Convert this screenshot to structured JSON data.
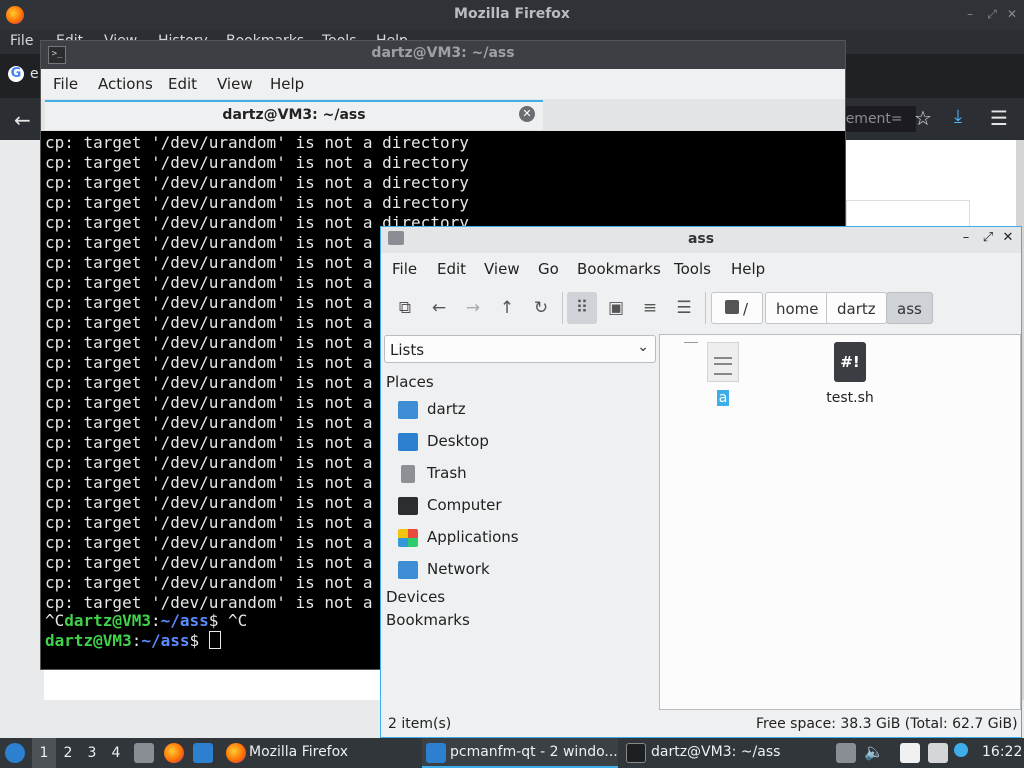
{
  "firefox": {
    "title": "Mozilla Firefox",
    "menu": [
      "File",
      "Edit",
      "View",
      "History",
      "Bookmarks",
      "Tools",
      "Help"
    ],
    "tab_favicon": "G",
    "tab_title": "e",
    "url_fragment": "cement=",
    "icons": {
      "back": "←",
      "star": "☆",
      "download": "⤓",
      "menu": "☰",
      "min": "–",
      "max": "⤢",
      "close": "✕"
    }
  },
  "terminal": {
    "title": "dartz@VM3: ~/ass",
    "menu": [
      "File",
      "Actions",
      "Edit",
      "View",
      "Help"
    ],
    "tab_title": "dartz@VM3: ~/ass",
    "tab_close": "✕",
    "line_text": "cp: target '/dev/urandom' is not a directory",
    "lines": [
      "cp: target '/dev/urandom' is not a directory",
      "cp: target '/dev/urandom' is not a directory",
      "cp: target '/dev/urandom' is not a directory",
      "cp: target '/dev/urandom' is not a directory",
      "cp: target '/dev/urandom' is not a directory",
      "cp: target '/dev/urandom' is not a directory",
      "cp: target '/dev/urandom' is not a directory",
      "cp: target '/dev/urandom' is not a directory",
      "cp: target '/dev/urandom' is not a directory",
      "cp: target '/dev/urandom' is not a directory",
      "cp: target '/dev/urandom' is not a directory",
      "cp: target '/dev/urandom' is not a directory",
      "cp: target '/dev/urandom' is not a directory",
      "cp: target '/dev/urandom' is not a directory",
      "cp: target '/dev/urandom' is not a directory",
      "cp: target '/dev/urandom' is not a directory",
      "cp: target '/dev/urandom' is not a directory",
      "cp: target '/dev/urandom' is not a directory",
      "cp: target '/dev/urandom' is not a directory",
      "cp: target '/dev/urandom' is not a directory",
      "cp: target '/dev/urandom' is not a directory",
      "cp: target '/dev/urandom' is not a directory",
      "cp: target '/dev/urandom' is not a directory",
      "cp: target '/dev/urandom' is not a directory"
    ],
    "prompt1": {
      "prefix": "^C",
      "user": "dartz@VM3",
      "sep": ":",
      "path": "~/ass",
      "suffix": "$ ^C"
    },
    "prompt2": {
      "user": "dartz@VM3",
      "sep": ":",
      "path": "~/ass",
      "suffix": "$ "
    }
  },
  "filemanager": {
    "title": "ass",
    "menu": [
      "File",
      "Edit",
      "View",
      "Go",
      "Bookmarks",
      "Tools",
      "Help"
    ],
    "breadcrumbs": [
      "/",
      "home",
      "dartz",
      "ass"
    ],
    "side_selector": "Lists",
    "places_header": "Places",
    "places": [
      "dartz",
      "Desktop",
      "Trash",
      "Computer",
      "Applications",
      "Network"
    ],
    "devices_header": "Devices",
    "bookmarks_header": "Bookmarks",
    "files": [
      {
        "name": "a",
        "type": "text"
      },
      {
        "name": "test.sh",
        "type": "script"
      }
    ],
    "script_glyph": "#!",
    "status_left": "2 item(s)",
    "status_right": "Free space: 38.3 GiB (Total: 62.7 GiB)"
  },
  "taskbar": {
    "workspaces": [
      "1",
      "2",
      "3",
      "4"
    ],
    "tasks": [
      "Mozilla Firefox",
      "pcmanfm-qt - 2 windo...",
      "dartz@VM3: ~/ass"
    ],
    "clock": "16:22"
  }
}
